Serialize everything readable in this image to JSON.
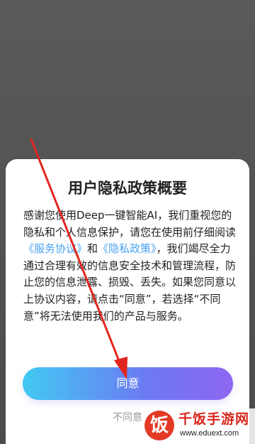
{
  "dialog": {
    "title": "用户隐私政策概要",
    "body_part1": "感谢您使用Deep一键智能AI，我们重视您的隐私和个人信息保护，请您在使用前仔细阅读",
    "service_agreement_link": "《服务协议》",
    "connector": "和",
    "privacy_policy_link": "《隐私政策》",
    "body_part2": "，我们竭尽全力通过合理有效的信息安全技术和管理流程，防止您的信息泄露、损毁、丢失。如果您同意以上协议内容，请点击“同意”，若选择“不同意”将无法使用我们的产品与服务。",
    "agree_button": "同意",
    "disagree_button": "不同意"
  },
  "watermark": {
    "logo_char": "饭",
    "title": "千饭手游网",
    "url": "www.eduext.com"
  },
  "colors": {
    "link": "#4aa2f3",
    "button_gradient_start": "#41c9f2",
    "button_gradient_end": "#8f66f2",
    "annotation_arrow": "#e0261f"
  },
  "annotation": {
    "arrow_icon": "red-arrow-pointing-to-agree"
  }
}
